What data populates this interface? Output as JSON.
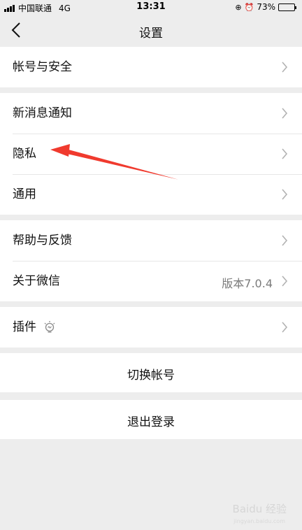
{
  "status_bar": {
    "carrier": "中国联通",
    "network": "4G",
    "time": "13:31",
    "battery_percent": "73%",
    "battery_level": 0.73
  },
  "nav": {
    "title": "设置"
  },
  "groups": {
    "account": {
      "label": "帐号与安全"
    },
    "notify": {
      "label": "新消息通知"
    },
    "privacy": {
      "label": "隐私"
    },
    "general": {
      "label": "通用"
    },
    "help": {
      "label": "帮助与反馈"
    },
    "about": {
      "label": "关于微信",
      "value": "版本7.0.4"
    },
    "plugins": {
      "label": "插件"
    }
  },
  "actions": {
    "switch_account": "切换帐号",
    "logout": "退出登录"
  },
  "watermark": {
    "text": "Baidu 经验",
    "sub": "jingyan.baidu.com"
  },
  "colors": {
    "background": "#ededed",
    "cell": "#ffffff",
    "separator": "#e6e6e6",
    "chevron": "#b2b2b2",
    "annotation_arrow": "#f03a2e"
  }
}
